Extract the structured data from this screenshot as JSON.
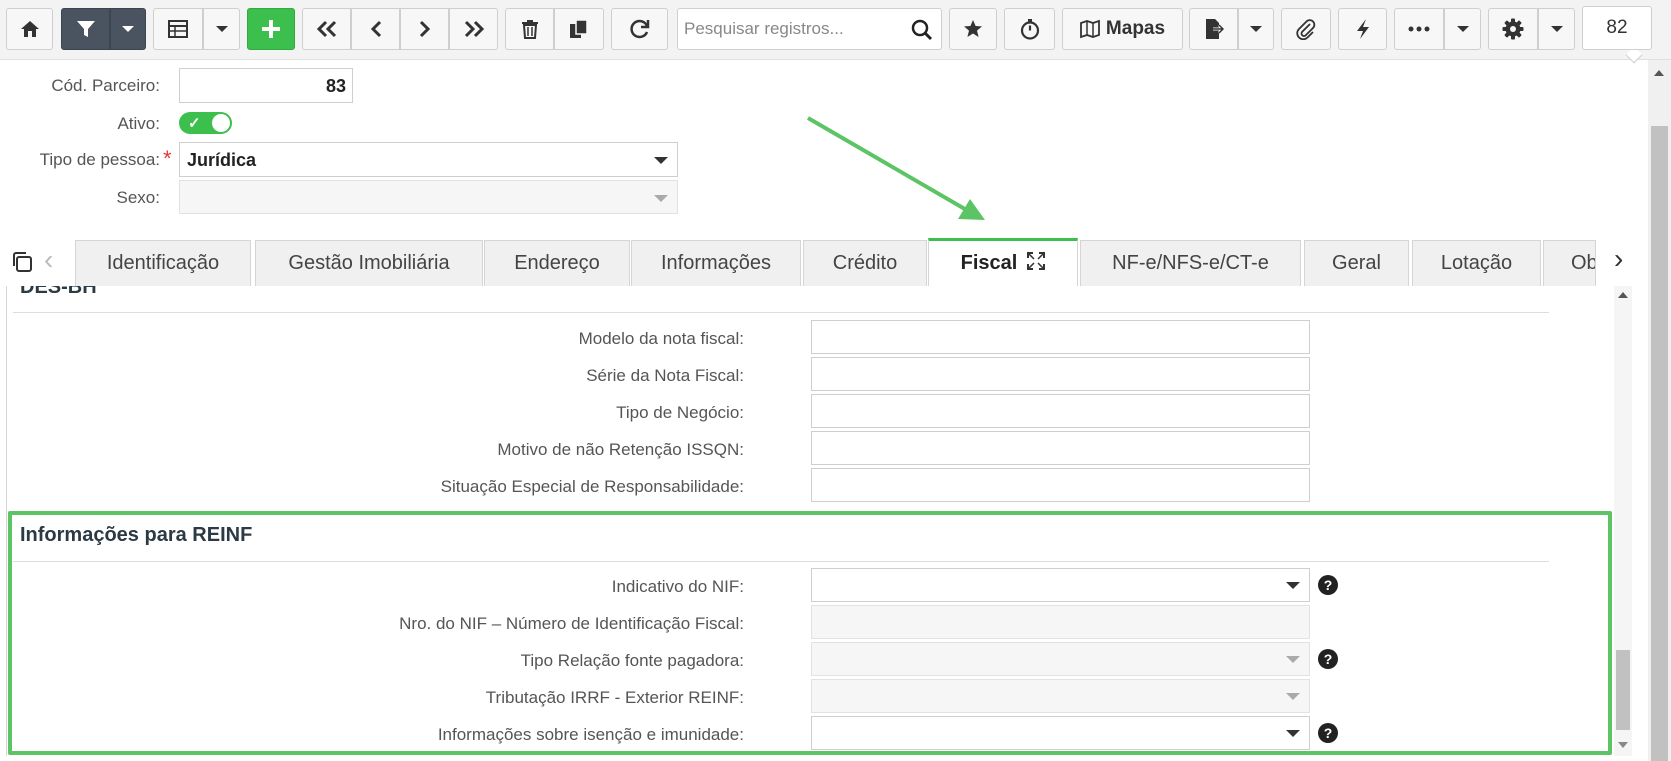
{
  "toolbar": {
    "search_placeholder": "Pesquisar registros...",
    "mapas_label": "Mapas",
    "record_counter": "82"
  },
  "header": {
    "cod_parceiro_label": "Cód. Parceiro:",
    "cod_parceiro_value": "83",
    "ativo_label": "Ativo:",
    "ativo_on": true,
    "tipo_pessoa_label": "Tipo de pessoa:",
    "tipo_pessoa_value": "Jurídica",
    "required_mark": "*",
    "sexo_label": "Sexo:",
    "sexo_value": ""
  },
  "tabs": [
    {
      "label": "Identificação",
      "active": false
    },
    {
      "label": "Gestão Imobiliária",
      "active": false
    },
    {
      "label": "Endereço",
      "active": false
    },
    {
      "label": "Informações",
      "active": false
    },
    {
      "label": "Crédito",
      "active": false
    },
    {
      "label": "Fiscal",
      "active": true
    },
    {
      "label": "NF-e/NFS-e/CT-e",
      "active": false
    },
    {
      "label": "Geral",
      "active": false
    },
    {
      "label": "Lotação",
      "active": false
    },
    {
      "label": "Ob",
      "active": false
    }
  ],
  "des_bh": {
    "title": "DES-BH",
    "fields": [
      {
        "label": "Modelo da nota fiscal:",
        "value": ""
      },
      {
        "label": "Série da Nota Fiscal:",
        "value": ""
      },
      {
        "label": "Tipo de Negócio:",
        "value": ""
      },
      {
        "label": "Motivo de não Retenção ISSQN:",
        "value": ""
      },
      {
        "label": "Situação Especial de Responsabilidade:",
        "value": ""
      }
    ]
  },
  "reinf": {
    "title": "Informações para REINF",
    "fields": [
      {
        "label": "Indicativo do NIF:",
        "value": "",
        "type": "select",
        "enabled": true,
        "help": true
      },
      {
        "label": "Nro. do NIF – Número de Identificação Fiscal:",
        "value": "",
        "type": "text",
        "enabled": false,
        "help": false
      },
      {
        "label": "Tipo Relação fonte pagadora:",
        "value": "",
        "type": "select",
        "enabled": false,
        "help": true
      },
      {
        "label": "Tributação IRRF - Exterior REINF:",
        "value": "",
        "type": "select",
        "enabled": false,
        "help": false
      },
      {
        "label": "Informações sobre isenção e imunidade:",
        "value": "",
        "type": "select",
        "enabled": true,
        "help": true
      }
    ],
    "help_glyph": "?"
  },
  "colors": {
    "accent_green": "#3cbf4c",
    "highlight_green": "#5cc464",
    "dark_button": "#4a5360",
    "required_red": "#e53935"
  }
}
